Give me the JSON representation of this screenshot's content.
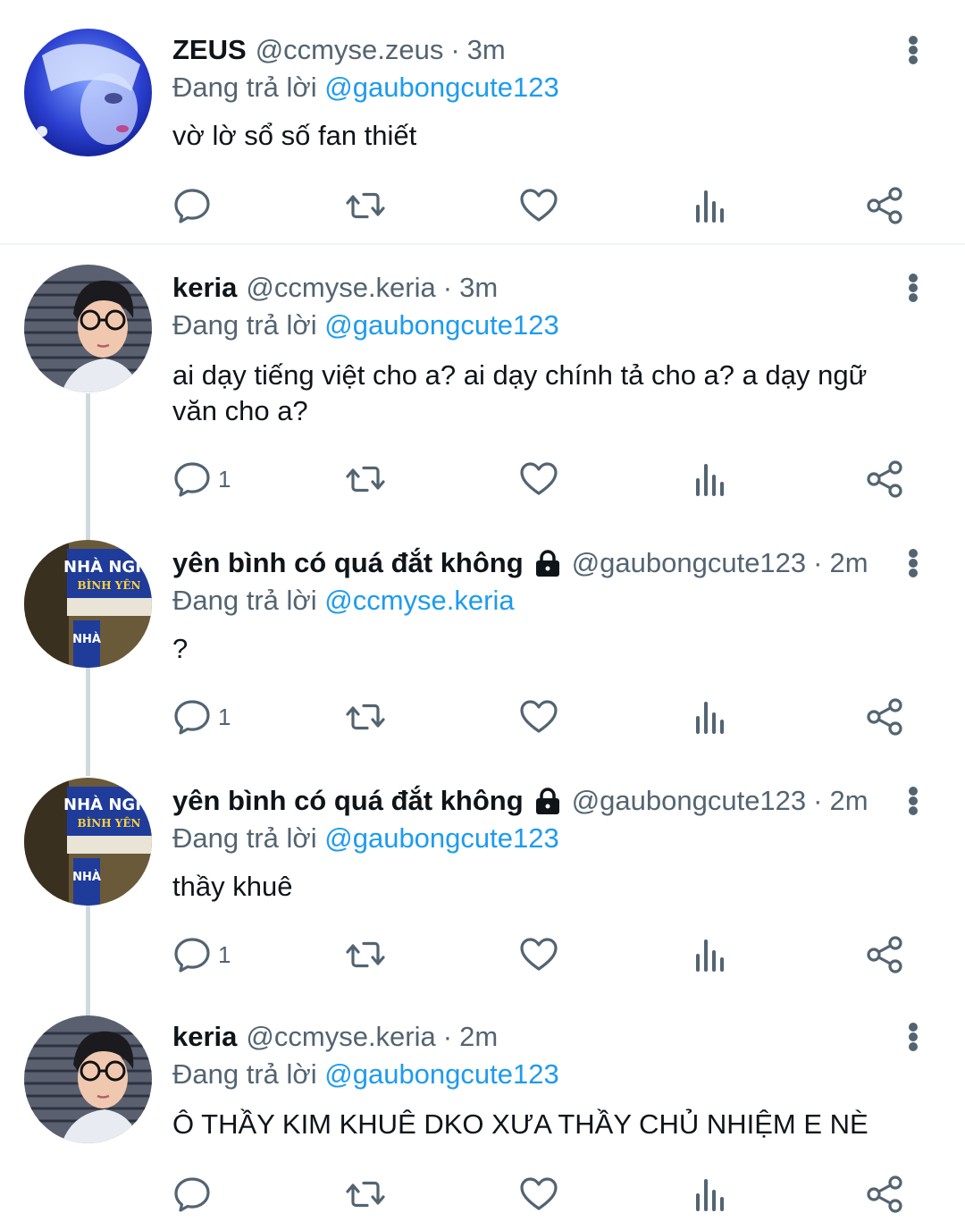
{
  "tweets": [
    {
      "name": "ZEUS",
      "handle": "@ccmyse.zeus",
      "separator": "·",
      "time": "3m",
      "replying_prefix": "Đang trả lời",
      "replying_to": "@gaubongcute123",
      "text": "vờ lờ sổ số fan thiết",
      "reply_count": "",
      "locked": false
    },
    {
      "name": "keria",
      "handle": "@ccmyse.keria",
      "separator": "·",
      "time": "3m",
      "replying_prefix": "Đang trả lời",
      "replying_to": "@gaubongcute123",
      "text": "ai dạy tiếng việt cho a? ai dạy chính tả cho a? a dạy ngữ văn cho a?",
      "reply_count": "1",
      "locked": false
    },
    {
      "name": "yên bình có quá đắt không",
      "handle": "@gaubongcute123",
      "separator": "·",
      "time": "2m",
      "replying_prefix": "Đang trả lời",
      "replying_to": "@ccmyse.keria",
      "text": "?",
      "reply_count": "1",
      "locked": true
    },
    {
      "name": "yên bình có quá đắt không",
      "handle": "@gaubongcute123",
      "separator": "·",
      "time": "2m",
      "replying_prefix": "Đang trả lời",
      "replying_to": "@gaubongcute123",
      "text": "thầy khuê",
      "reply_count": "1",
      "locked": true
    },
    {
      "name": "keria",
      "handle": "@ccmyse.keria",
      "separator": "·",
      "time": "2m",
      "replying_prefix": "Đang trả lời",
      "replying_to": "@gaubongcute123",
      "text": "Ô THẦY KIM KHUÊ DKO XƯA THẦY CHỦ NHIỆM E NÈ",
      "reply_count": "",
      "locked": false
    }
  ],
  "icons": {
    "reply": "reply-icon",
    "retweet": "retweet-icon",
    "like": "heart-icon",
    "views": "views-icon",
    "share": "share-icon",
    "more": "more-vertical-icon",
    "lock": "lock-icon"
  },
  "colors": {
    "text": "#0f1419",
    "secondary": "#536471",
    "mention": "#1d9bf0",
    "thread_line": "#cfd9de"
  }
}
